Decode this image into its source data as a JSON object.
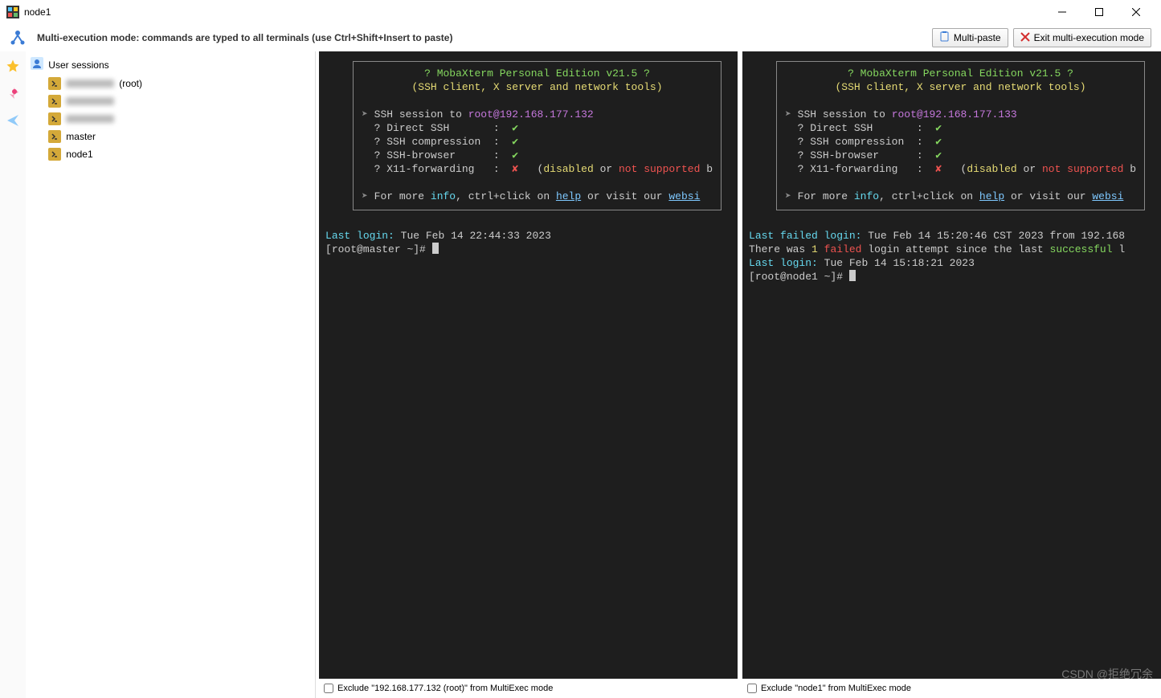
{
  "window": {
    "title": "node1"
  },
  "toolbar": {
    "mode_text": "Multi-execution mode: commands are typed to all terminals (use Ctrl+Shift+Insert to paste)",
    "multipaste_label": "Multi-paste",
    "exit_label": "Exit multi-execution mode"
  },
  "sidebar": {
    "header": "User sessions",
    "items": [
      {
        "label_hidden": true,
        "suffix": " (root)"
      },
      {
        "label_hidden": true,
        "suffix": ""
      },
      {
        "label_hidden": true,
        "suffix": ""
      },
      {
        "label": "master"
      },
      {
        "label": "node1"
      }
    ]
  },
  "terminals": {
    "left": {
      "banner_title": "? MobaXterm Personal Edition v21.5 ?",
      "banner_sub": "(SSH client, X server and network tools)",
      "ssh_prefix": "SSH session to ",
      "ssh_target": "root@192.168.177.132",
      "rows": [
        {
          "label": "? Direct SSH",
          "sep": ":",
          "mark": "✔",
          "ok": true
        },
        {
          "label": "? SSH compression",
          "sep": ":",
          "mark": "✔",
          "ok": true
        },
        {
          "label": "? SSH-browser",
          "sep": ":",
          "mark": "✔",
          "ok": true
        },
        {
          "label": "? X11-forwarding",
          "sep": ":",
          "mark": "✘",
          "ok": false,
          "tail_a": "(",
          "tail_b": "disabled",
          "tail_c": " or ",
          "tail_d": "not supported",
          "tail_e": " b"
        }
      ],
      "more_a": "For more ",
      "more_b": "info",
      "more_c": ", ctrl+click on ",
      "more_help": "help",
      "more_d": " or visit our ",
      "more_site": "websi",
      "lastlogin_label": "Last login:",
      "lastlogin_value": " Tue Feb 14 22:44:33 2023",
      "prompt": "[root@master ~]# ",
      "exclude": "Exclude \"192.168.177.132 (root)\" from MultiExec mode"
    },
    "right": {
      "banner_title": "? MobaXterm Personal Edition v21.5 ?",
      "banner_sub": "(SSH client, X server and network tools)",
      "ssh_prefix": "SSH session to ",
      "ssh_target": "root@192.168.177.133",
      "rows": [
        {
          "label": "? Direct SSH",
          "sep": ":",
          "mark": "✔",
          "ok": true
        },
        {
          "label": "? SSH compression",
          "sep": ":",
          "mark": "✔",
          "ok": true
        },
        {
          "label": "? SSH-browser",
          "sep": ":",
          "mark": "✔",
          "ok": true
        },
        {
          "label": "? X11-forwarding",
          "sep": ":",
          "mark": "✘",
          "ok": false,
          "tail_a": "(",
          "tail_b": "disabled",
          "tail_c": " or ",
          "tail_d": "not supported",
          "tail_e": " b"
        }
      ],
      "more_a": "For more ",
      "more_b": "info",
      "more_c": ", ctrl+click on ",
      "more_help": "help",
      "more_d": " or visit our ",
      "more_site": "websi",
      "failed_a": "Last failed login:",
      "failed_b": " Tue Feb 14 15:20:46 CST 2023 from 192.168",
      "fline_a": "There was ",
      "fline_b": "1",
      "fline_c": " ",
      "fline_d": "failed",
      "fline_e": " login attempt since the last ",
      "fline_f": "successful",
      "fline_g": " l",
      "lastlogin_label": "Last login:",
      "lastlogin_value": " Tue Feb 14 15:18:21 2023",
      "prompt": "[root@node1 ~]# ",
      "exclude": "Exclude \"node1\" from MultiExec mode"
    }
  },
  "watermark": "CSDN @拒绝冗余"
}
